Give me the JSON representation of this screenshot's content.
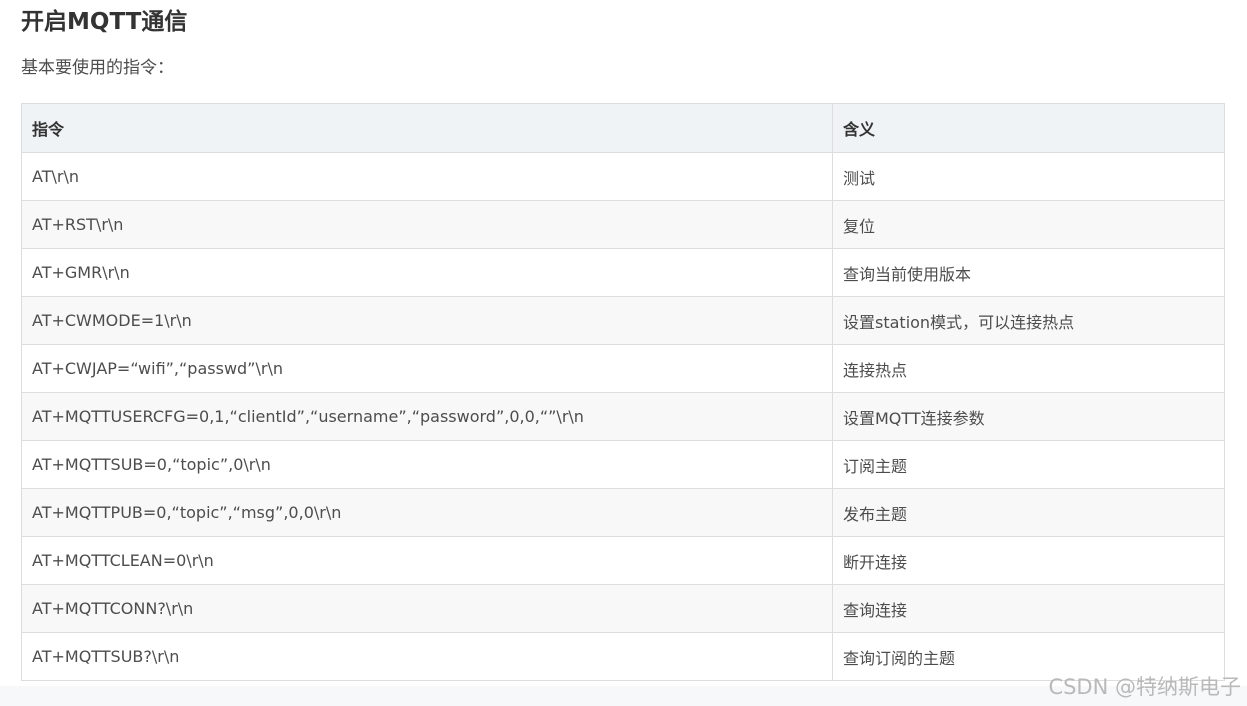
{
  "article": {
    "title": "开启MQTT通信",
    "intro": "基本要使用的指令："
  },
  "table": {
    "headers": [
      "指令",
      "含义"
    ],
    "rows": [
      [
        "AT\\r\\n",
        "测试"
      ],
      [
        "AT+RST\\r\\n",
        "复位"
      ],
      [
        "AT+GMR\\r\\n",
        "查询当前使用版本"
      ],
      [
        "AT+CWMODE=1\\r\\n",
        "设置station模式，可以连接热点"
      ],
      [
        "AT+CWJAP=“wifi”,“passwd”\\r\\n",
        "连接热点"
      ],
      [
        "AT+MQTTUSERCFG=0,1,“clientId”,“username”,“password”,0,0,“”\\r\\n",
        "设置MQTT连接参数"
      ],
      [
        "AT+MQTTSUB=0,“topic”,0\\r\\n",
        "订阅主题"
      ],
      [
        "AT+MQTTPUB=0,“topic”,“msg”,0,0\\r\\n",
        "发布主题"
      ],
      [
        "AT+MQTTCLEAN=0\\r\\n",
        "断开连接"
      ],
      [
        "AT+MQTTCONN?\\r\\n",
        "查询连接"
      ],
      [
        "AT+MQTTSUB?\\r\\n",
        "查询订阅的主题"
      ]
    ]
  },
  "watermark": "CSDN @特纳斯电子"
}
